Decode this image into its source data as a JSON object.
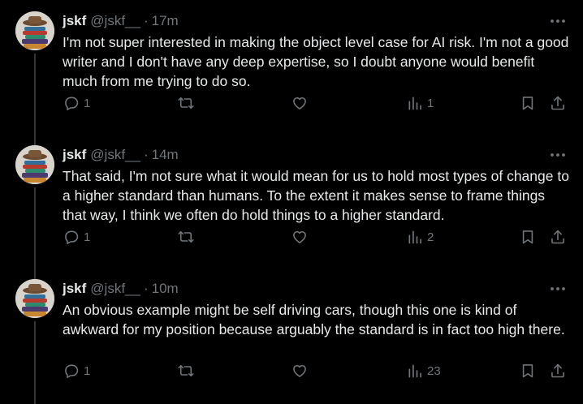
{
  "colors": {
    "background": "#000000",
    "text_primary": "#e7e9ea",
    "text_secondary": "#71767b",
    "thread_line": "#333639"
  },
  "icons": {
    "reply": "speech-bubble",
    "repost": "two-arrows-loop",
    "like": "heart-outline",
    "views": "bar-chart",
    "bookmark": "bookmark-outline",
    "share": "upload-arrow",
    "more": "three-dots"
  },
  "tweets": [
    {
      "name": "jskf",
      "handle": "@jskf__",
      "separator": "·",
      "time": "17m",
      "text": "I'm not super interested in making the object level case for AI risk. I'm not a good writer and I don't have any deep expertise, so I doubt anyone would benefit much from me trying to do so.",
      "replies": "1",
      "reposts": "",
      "likes": "",
      "views": "1"
    },
    {
      "name": "jskf",
      "handle": "@jskf__",
      "separator": "·",
      "time": "14m",
      "text": "That said, I'm not sure what it would mean for us to hold most types of change to a higher standard than humans. To the extent it makes sense to frame things that way, I think we often do hold things to a higher standard.",
      "replies": "1",
      "reposts": "",
      "likes": "",
      "views": "2"
    },
    {
      "name": "jskf",
      "handle": "@jskf__",
      "separator": "·",
      "time": "10m",
      "text": "An obvious example might be self driving cars, though this one is kind of awkward for my position because arguably the standard is in fact too high there.",
      "replies": "1",
      "reposts": "",
      "likes": "",
      "views": "23"
    }
  ]
}
